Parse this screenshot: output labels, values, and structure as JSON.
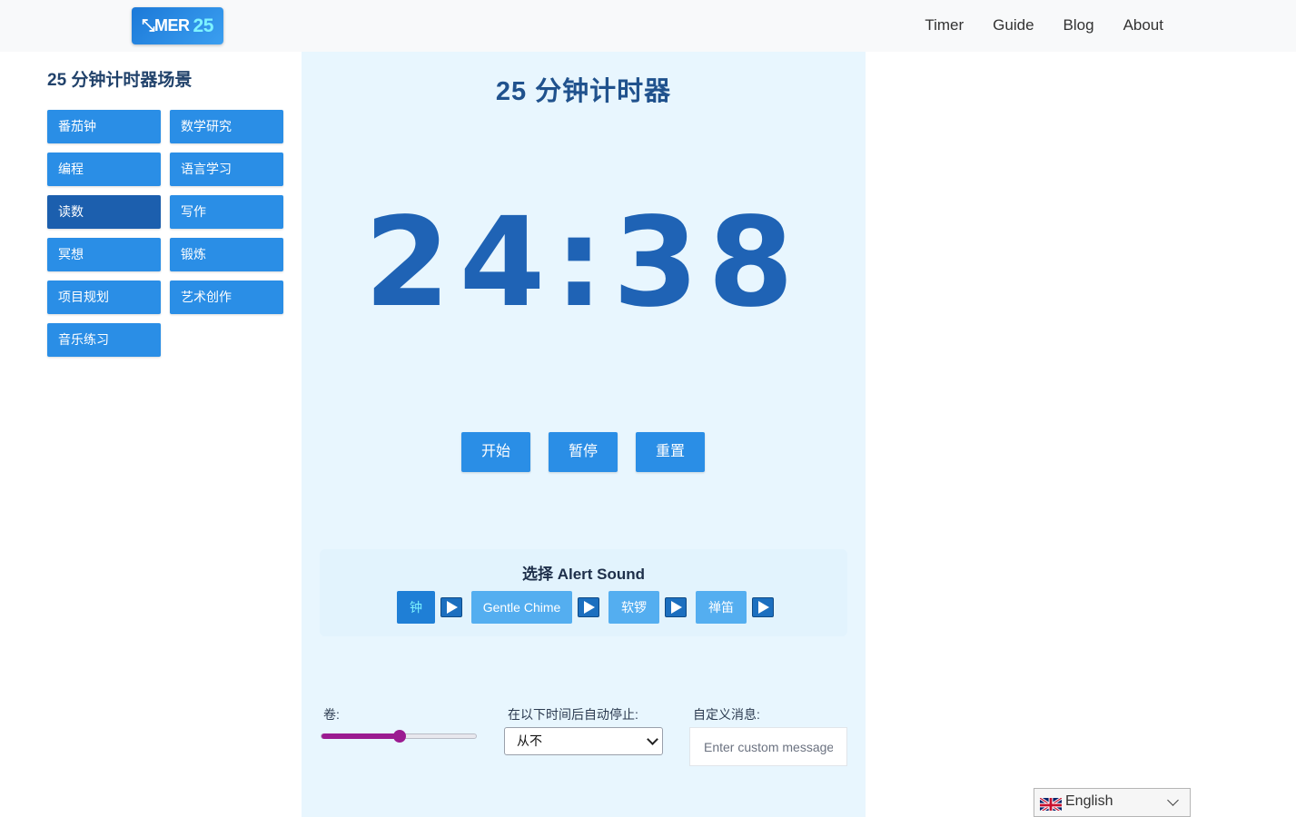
{
  "header": {
    "logo_text": "MER",
    "logo_number": "25",
    "nav": [
      "Timer",
      "Guide",
      "Blog",
      "About"
    ]
  },
  "sidebar": {
    "title": "25 分钟计时器场景",
    "items": [
      "番茄钟",
      "数学研究",
      "编程",
      "语言学习",
      "读数",
      "写作",
      "冥想",
      "锻炼",
      "项目规划",
      "艺术创作",
      "音乐练习"
    ],
    "active_index": 4
  },
  "main": {
    "title": "25 分钟计时器",
    "time": "24:38",
    "controls": {
      "start": "开始",
      "pause": "暂停",
      "reset": "重置"
    },
    "sound": {
      "title": "选择 Alert Sound",
      "options": [
        "钟",
        "Gentle Chime",
        "软锣",
        "禅笛"
      ],
      "selected_index": 0
    },
    "settings": {
      "volume_label": "卷:",
      "volume_value": 0.5,
      "auto_stop_label": "在以下时间后自动停止:",
      "auto_stop_value": "从不",
      "custom_message_label": "自定义消息:",
      "custom_message_placeholder": "Enter custom message"
    }
  },
  "language": {
    "selected": "English"
  },
  "colors": {
    "primary": "#2a8ee6",
    "active": "#1c5fae",
    "clock": "#1f63b5",
    "panel_bg": "#e8f6fe",
    "slider": "#9b1b91"
  }
}
